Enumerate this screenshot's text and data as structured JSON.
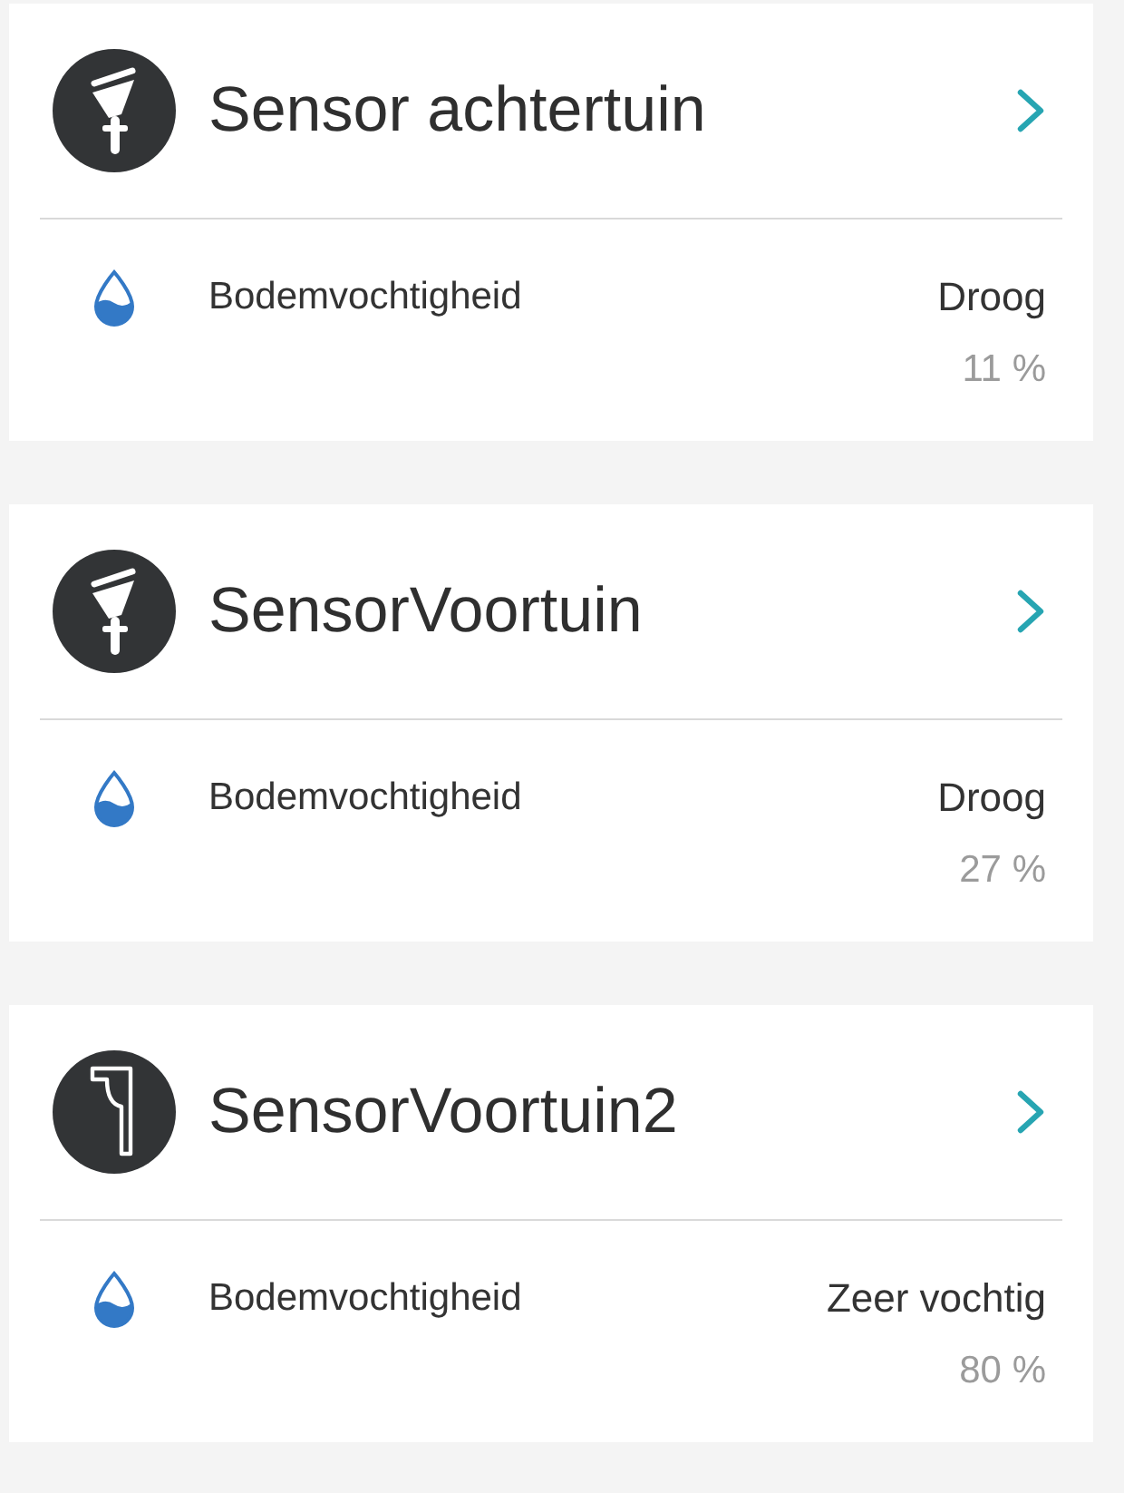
{
  "sensors": [
    {
      "name": "Sensor achtertuin",
      "kind": "funnel",
      "measurement": {
        "label": "Bodemvochtigheid",
        "status": "Droog",
        "value": "11 %"
      }
    },
    {
      "name": "SensorVoortuin",
      "kind": "funnel",
      "measurement": {
        "label": "Bodemvochtigheid",
        "status": "Droog",
        "value": "27 %"
      }
    },
    {
      "name": "SensorVoortuin2",
      "kind": "corner",
      "measurement": {
        "label": "Bodemvochtigheid",
        "status": "Zeer vochtig",
        "value": "80 %"
      }
    }
  ]
}
